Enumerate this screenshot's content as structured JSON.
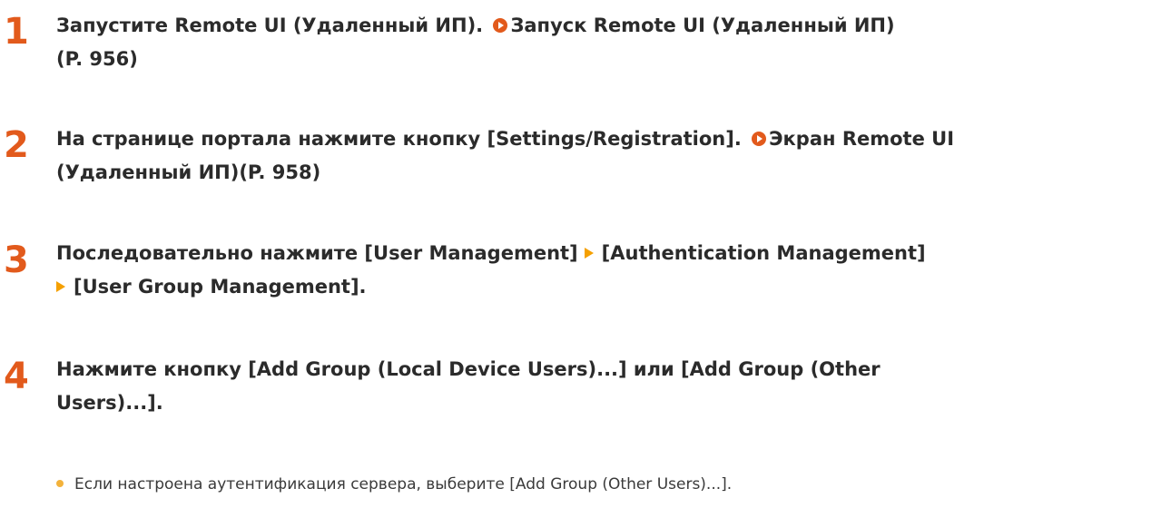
{
  "steps": [
    {
      "number": "1",
      "text": "Запустите Remote UI (Удаленный ИП).",
      "link": "Запуск Remote UI (Удаленный ИП)",
      "link_page": "(P. 956)"
    },
    {
      "number": "2",
      "text": "На странице портала нажмите кнопку [Settings/Registration].",
      "link": "Экран Remote UI",
      "link_cont": "(Удаленный ИП)(P. 958)"
    },
    {
      "number": "3",
      "text_a": "Последовательно нажмите [User Management]",
      "text_b": "[Authentication Management]",
      "text_c": "[User Group Management]."
    },
    {
      "number": "4",
      "text_a": "Нажмите кнопку [Add Group (Local Device Users)...] или [Add Group (Other",
      "text_b": "Users)...]."
    }
  ],
  "bullet": "Если настроена аутентификация сервера, выберите [Add Group (Other Users)...].",
  "colors": {
    "step_number": "#e25a1c",
    "link_icon": "#e25a1c",
    "separator": "#f5a000",
    "bullet": "#f3b23b"
  }
}
